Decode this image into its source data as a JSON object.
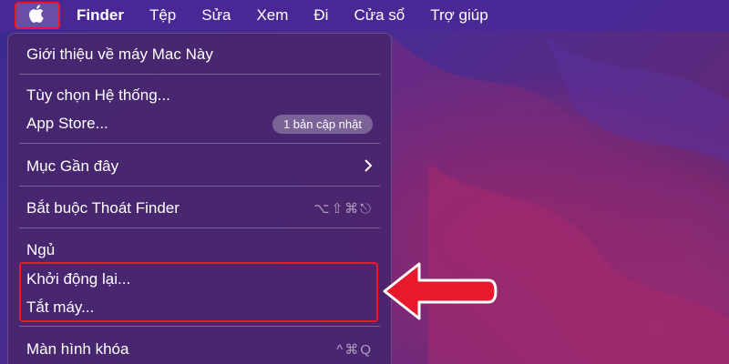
{
  "menubar": {
    "apple_icon": "apple-logo-icon",
    "app_name": "Finder",
    "items": [
      {
        "label": "Tệp"
      },
      {
        "label": "Sửa"
      },
      {
        "label": "Xem"
      },
      {
        "label": "Đi"
      },
      {
        "label": "Cửa sổ"
      },
      {
        "label": "Trợ giúp"
      }
    ]
  },
  "apple_menu": {
    "about": "Giới thiệu về máy Mac Này",
    "system_prefs": "Tùy chọn Hệ thống...",
    "app_store": "App Store...",
    "app_store_badge": "1 bản cập nhật",
    "recent_items": "Mục Gần đây",
    "force_quit": "Bắt buộc Thoát Finder",
    "force_quit_shortcut": "⌥⇧⌘⎋",
    "sleep": "Ngủ",
    "restart": "Khởi động lại...",
    "shutdown": "Tắt máy...",
    "lock_screen": "Màn hình khóa",
    "lock_screen_shortcut": "^⌘Q"
  },
  "colors": {
    "highlight": "#e8192c",
    "menubar": "#4a2896",
    "menu_bg": "#48266e"
  }
}
